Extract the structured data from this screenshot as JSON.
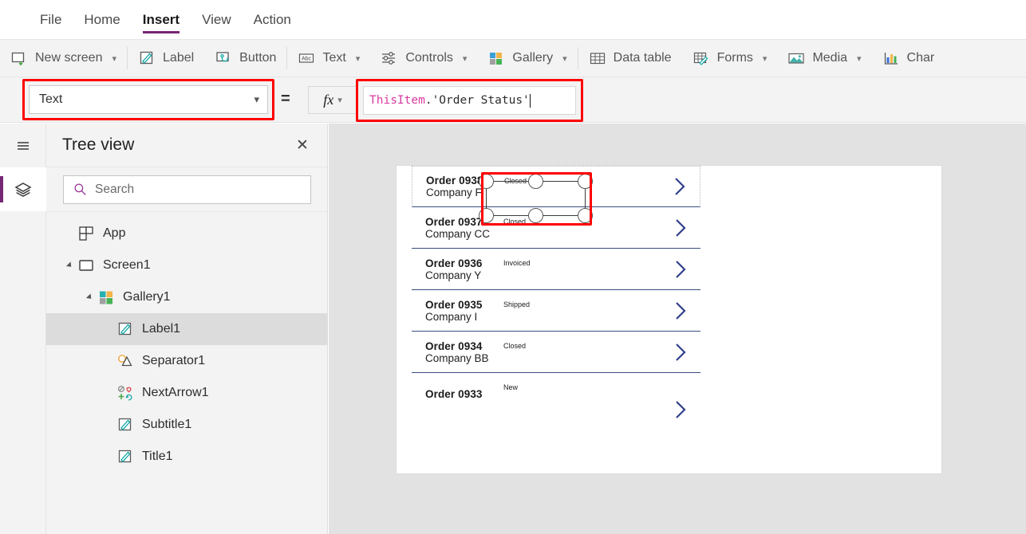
{
  "menu": {
    "items": [
      {
        "label": "File",
        "active": false
      },
      {
        "label": "Home",
        "active": false
      },
      {
        "label": "Insert",
        "active": true
      },
      {
        "label": "View",
        "active": false
      },
      {
        "label": "Action",
        "active": false
      }
    ]
  },
  "ribbon": {
    "items": [
      {
        "label": "New screen",
        "icon": "new-screen-icon",
        "caret": true
      },
      {
        "label": "Label",
        "icon": "label-icon",
        "caret": false
      },
      {
        "label": "Button",
        "icon": "button-icon",
        "caret": false
      },
      {
        "label": "Text",
        "icon": "text-abc-icon",
        "caret": true
      },
      {
        "label": "Controls",
        "icon": "controls-sliders-icon",
        "caret": true
      },
      {
        "label": "Gallery",
        "icon": "gallery-grid-icon",
        "caret": true
      },
      {
        "label": "Data table",
        "icon": "data-table-icon",
        "caret": false
      },
      {
        "label": "Forms",
        "icon": "forms-icon",
        "caret": true
      },
      {
        "label": "Media",
        "icon": "media-image-icon",
        "caret": true
      },
      {
        "label": "Char",
        "icon": "charts-bar-icon",
        "caret": false
      }
    ]
  },
  "formula_bar": {
    "property_value": "Text",
    "equals": "=",
    "fx_label": "fx",
    "formula_tokens": [
      {
        "text": "ThisItem",
        "type": "item"
      },
      {
        "text": ".'Order Status'",
        "type": "plain"
      }
    ],
    "formula_full": "ThisItem.'Order Status'"
  },
  "tree": {
    "title": "Tree view",
    "close_label": "✕",
    "search_placeholder": "Search",
    "search_value": "",
    "nodes": [
      {
        "label": "App",
        "depth": 0,
        "icon": "app-icon",
        "twisty": "none",
        "selected": false
      },
      {
        "label": "Screen1",
        "depth": 1,
        "icon": "screen-icon",
        "twisty": "expanded",
        "selected": false
      },
      {
        "label": "Gallery1",
        "depth": 2,
        "icon": "gallery-icon",
        "twisty": "expanded",
        "selected": false
      },
      {
        "label": "Label1",
        "depth": 3,
        "icon": "label-icon",
        "twisty": "none",
        "selected": true
      },
      {
        "label": "Separator1",
        "depth": 3,
        "icon": "shapes-icon",
        "twisty": "none",
        "selected": false
      },
      {
        "label": "NextArrow1",
        "depth": 3,
        "icon": "icons-grid-icon",
        "twisty": "none",
        "selected": false
      },
      {
        "label": "Subtitle1",
        "depth": 3,
        "icon": "label-icon",
        "twisty": "none",
        "selected": false
      },
      {
        "label": "Title1",
        "depth": 3,
        "icon": "label-icon",
        "twisty": "none",
        "selected": false
      }
    ]
  },
  "canvas": {
    "gallery_rows": [
      {
        "title": "Order 0938",
        "subtitle": "Company F",
        "status": "Closed",
        "selected_label": true,
        "clipped": false
      },
      {
        "title": "Order 0937",
        "subtitle": "Company CC",
        "status": "Closed",
        "selected_label": false,
        "clipped": false
      },
      {
        "title": "Order 0936",
        "subtitle": "Company Y",
        "status": "Invoiced",
        "selected_label": false,
        "clipped": false
      },
      {
        "title": "Order 0935",
        "subtitle": "Company I",
        "status": "Shipped",
        "selected_label": false,
        "clipped": false
      },
      {
        "title": "Order 0934",
        "subtitle": "Company BB",
        "status": "Closed",
        "selected_label": false,
        "clipped": false
      },
      {
        "title": "Order 0933",
        "subtitle": "",
        "status": "New",
        "selected_label": false,
        "clipped": true
      }
    ]
  },
  "rail": {
    "items": [
      {
        "name": "hamburger",
        "icon": "hamburger-menu-icon",
        "active": false
      },
      {
        "name": "tree-view",
        "icon": "layers-icon",
        "active": true
      }
    ]
  },
  "colors": {
    "accent_purple": "#742774",
    "annotation_red": "#ff0000",
    "chevron_blue": "#3b4c81",
    "formula_item_pink": "#d83b9f",
    "ribbon_bg": "#f3f3f3",
    "workspace_bg": "#e2e2e2"
  }
}
